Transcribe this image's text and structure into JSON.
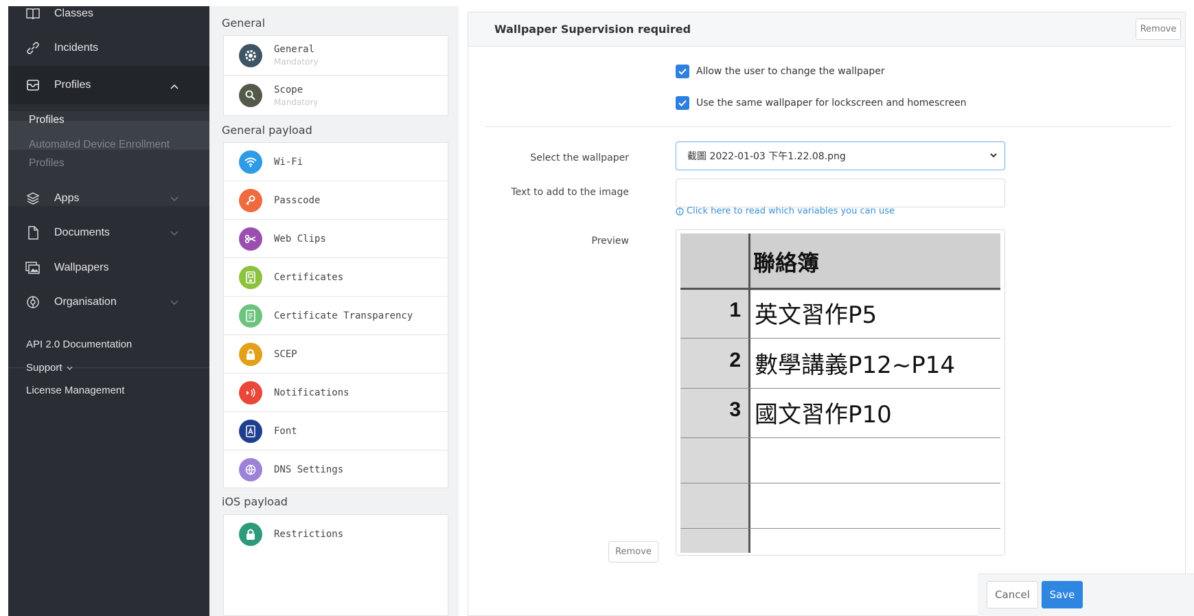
{
  "sidebar": {
    "nav": {
      "classes": "Classes",
      "incidents": "Incidents",
      "profiles": "Profiles",
      "apps": "Apps",
      "documents": "Documents",
      "wallpapers": "Wallpapers",
      "organisation": "Organisation"
    },
    "profiles_sub": {
      "profiles": "Profiles",
      "ade_line1": "Automated Device Enrollment",
      "ade_line2": "Profiles"
    },
    "links": {
      "api": "API 2.0 Documentation",
      "support": "Support",
      "license": "License Management"
    }
  },
  "payloads": {
    "section_general": "General",
    "general_items": [
      {
        "label": "General",
        "sub": "Mandatory"
      },
      {
        "label": "Scope",
        "sub": "Mandatory"
      }
    ],
    "section_general_payload": "General payload",
    "general_payload_items": [
      {
        "label": "Wi-Fi"
      },
      {
        "label": "Passcode"
      },
      {
        "label": "Web Clips"
      },
      {
        "label": "Certificates"
      },
      {
        "label": "Certificate Transparency"
      },
      {
        "label": "SCEP"
      },
      {
        "label": "Notifications"
      },
      {
        "label": "Font"
      },
      {
        "label": "DNS Settings"
      }
    ],
    "section_ios_payload": "iOS payload",
    "ios_items": [
      {
        "label": "Restrictions"
      }
    ]
  },
  "panel": {
    "title": "Wallpaper Supervision required",
    "remove_top": "Remove",
    "checkbox_allow": "Allow the user to change the wallpaper",
    "checkbox_same": "Use the same wallpaper for lockscreen and homescreen",
    "select_label": "Select the wallpaper",
    "select_value": "截圖 2022-01-03 下午1.22.08.png",
    "text_label": "Text to add to the image",
    "text_value": "",
    "help_link": "Click here to read which variables you can use",
    "preview_label": "Preview",
    "remove_bottom": "Remove"
  },
  "preview_image": {
    "header": "聯絡簿",
    "rows": [
      {
        "num": "1",
        "text": "英文習作P5"
      },
      {
        "num": "2",
        "text": "數學講義P12~P14"
      },
      {
        "num": "3",
        "text": "國文習作P10"
      }
    ]
  },
  "footer": {
    "cancel": "Cancel",
    "save": "Save"
  },
  "colors": {
    "sidebar_bg": "#2a2d33",
    "accent_blue": "#2f86e0",
    "checkbox_blue": "#2f7fe0",
    "link_blue": "#3a8fd6"
  }
}
